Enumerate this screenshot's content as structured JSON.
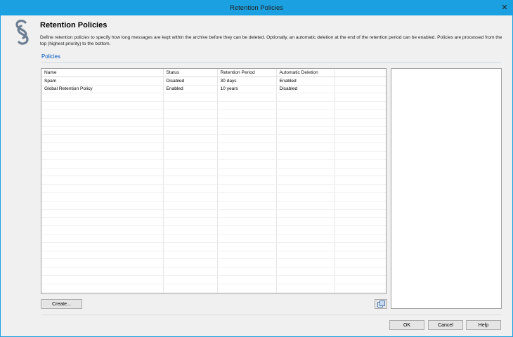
{
  "window": {
    "title": "Retention Policies",
    "close_glyph": "✕"
  },
  "header": {
    "icon": "section-sign-icon",
    "title": "Retention Policies",
    "description": "Define retention policies to specify how long messages are kept within the archive before they can be deleted. Optionally, an automatic deletion at the end of the retention period can be enabled. Policies are processed from the top (highest priority) to the bottom."
  },
  "policies": {
    "section_label": "Policies",
    "columns": [
      "Name",
      "Status",
      "Retention Period",
      "Automatic Deletion",
      ""
    ],
    "rows": [
      [
        "Spam",
        "Disabled",
        "30 days",
        "Enabled",
        ""
      ],
      [
        "Global Retention Policy",
        "Enabled",
        "10 years",
        "Disabled",
        ""
      ]
    ],
    "empty_row_count": 26,
    "create_label": "Create...",
    "export_icon": "export-icon"
  },
  "footer": {
    "ok_label": "OK",
    "cancel_label": "Cancel",
    "help_label": "Help"
  },
  "colors": {
    "title_bar": "#1ba1e2",
    "section_label": "#0055c4"
  }
}
